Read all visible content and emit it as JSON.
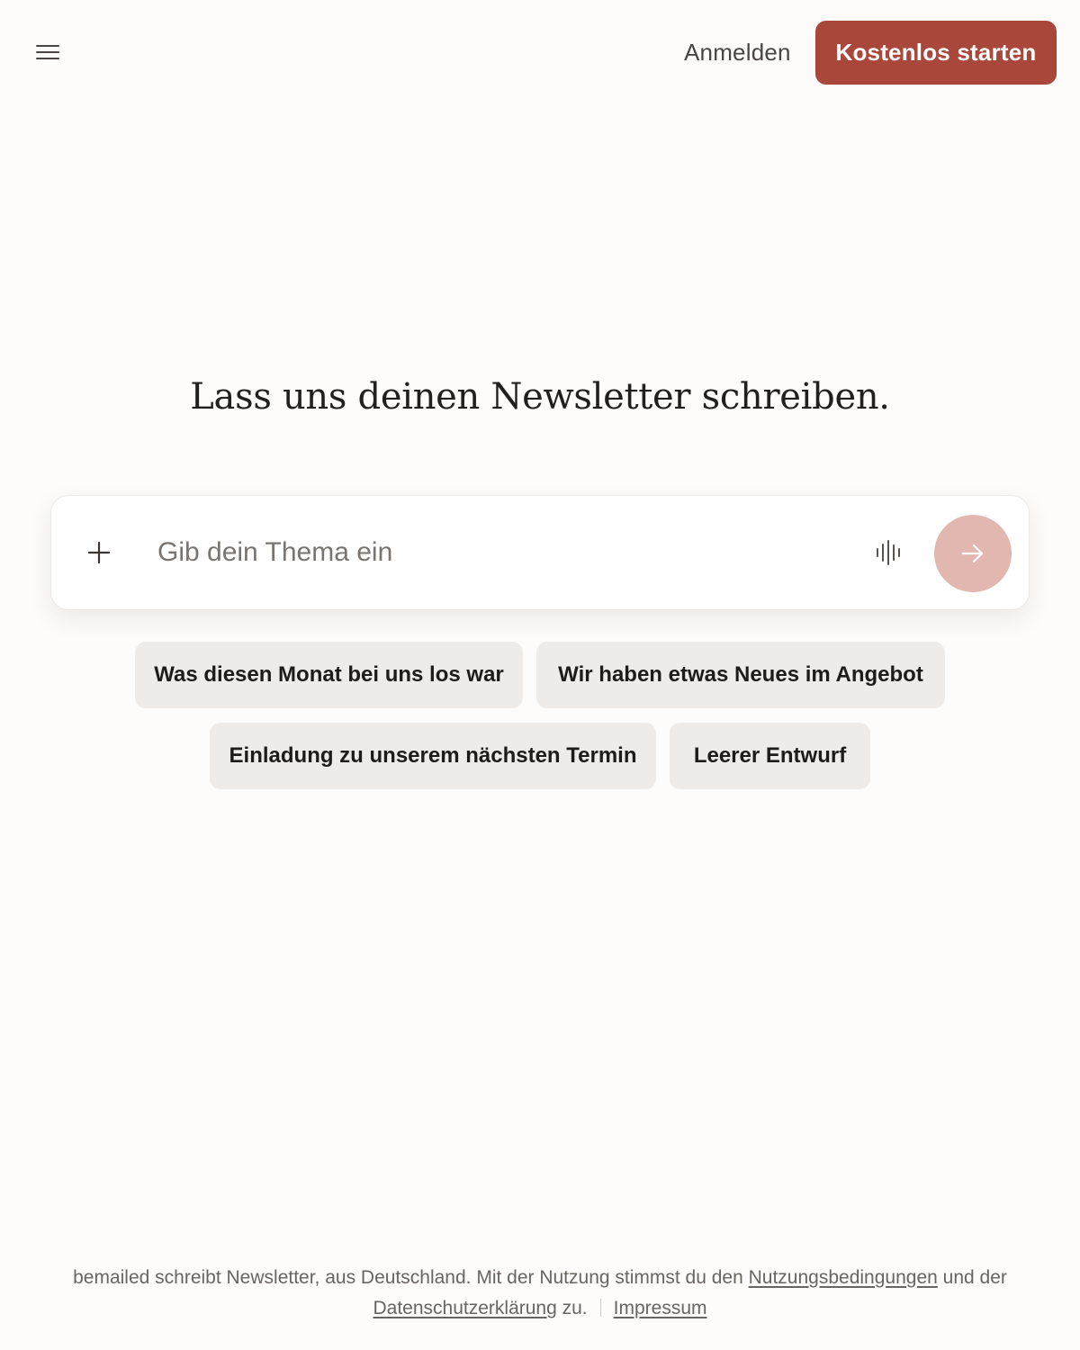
{
  "header": {
    "menu_icon": "menu-icon",
    "login_label": "Anmelden",
    "cta_label": "Kostenlos starten",
    "cta_color": "#a8473a"
  },
  "main": {
    "headline": "Lass uns deinen Newsletter schreiben.",
    "prompt": {
      "placeholder": "Gib dein Thema ein",
      "value": "",
      "add_icon": "plus-icon",
      "voice_icon": "voice-waveform-icon",
      "send_icon": "arrow-right-icon",
      "send_color": "#e2b7b0"
    },
    "suggestions": [
      "Was diesen Monat bei uns los war",
      "Wir haben etwas Neues im Angebot",
      "Einladung zu unserem nächsten Termin",
      "Leerer Entwurf"
    ]
  },
  "footer": {
    "text_part1": "bemailed schreibt Newsletter, aus Deutschland. Mit der Nutzung stimmst du den",
    "terms_link": "Nutzungsbedingungen",
    "text_part2": "und der",
    "privacy_link": "Datenschutzerklärung",
    "text_part3": "zu.",
    "imprint_link": "Impressum"
  }
}
